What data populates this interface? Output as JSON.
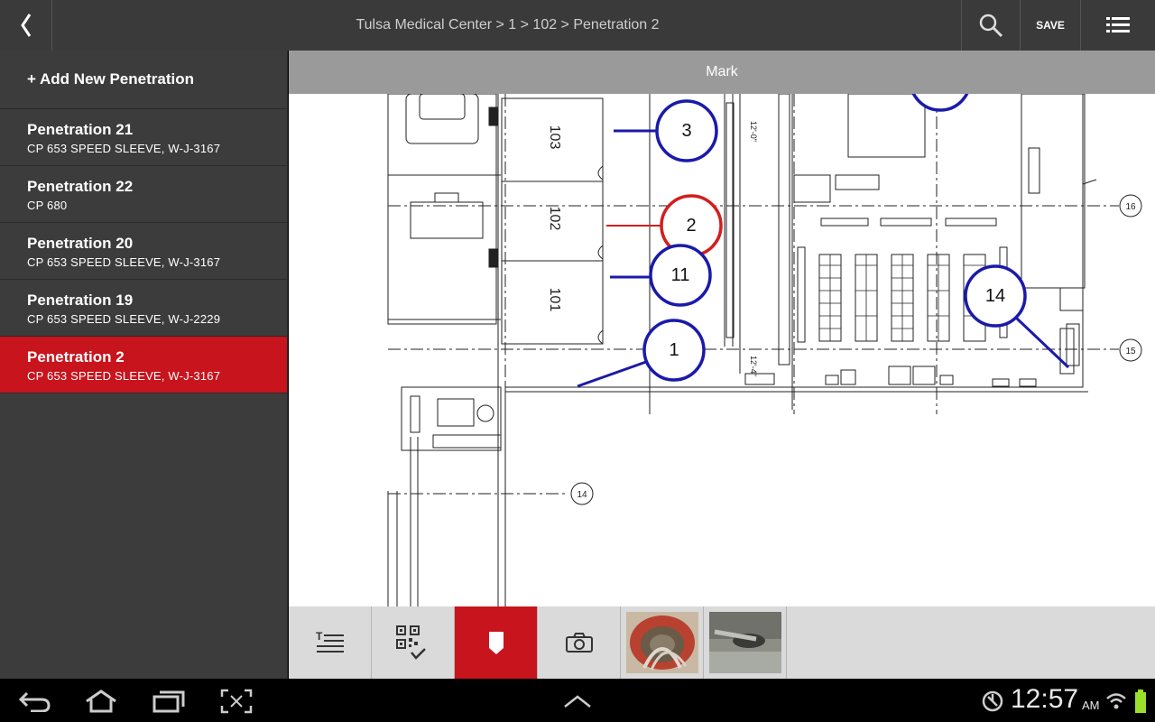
{
  "header": {
    "title": "Tulsa Medical Center > 1 > 102 > Penetration 2",
    "save_label": "SAVE",
    "back_icon": "back-chevron-icon",
    "search_icon": "search-icon",
    "menu_icon": "list-menu-icon"
  },
  "sidebar": {
    "add_label": "+ Add New Penetration",
    "items": [
      {
        "name": "Penetration 21",
        "detail": "CP 653 SPEED SLEEVE, W-J-3167"
      },
      {
        "name": "Penetration 22",
        "detail": "CP 680"
      },
      {
        "name": "Penetration 20",
        "detail": "CP 653 SPEED SLEEVE, W-J-3167"
      },
      {
        "name": "Penetration 19",
        "detail": "CP 653 SPEED SLEEVE, W-J-2229"
      },
      {
        "name": "Penetration 2",
        "detail": "CP 653 SPEED SLEEVE, W-J-3167",
        "selected": true
      }
    ]
  },
  "mark_bar": {
    "label": "Mark"
  },
  "floorplan": {
    "rooms": [
      "103",
      "102",
      "101"
    ],
    "markers": [
      "3",
      "2",
      "11",
      "1",
      "14"
    ],
    "grid_bubbles": [
      "16",
      "15",
      "14"
    ],
    "dims": [
      "12'-0\"",
      "12'-4\""
    ]
  },
  "toolbar": {
    "tools": [
      "text-list-icon",
      "qr-check-icon",
      "marker-icon",
      "camera-icon"
    ],
    "active_tool": "marker-icon",
    "photos": [
      "photo-thumbnail-1",
      "photo-thumbnail-2"
    ]
  },
  "system": {
    "time": "12:57",
    "ampm": "AM",
    "icons": [
      "back-nav-icon",
      "home-icon",
      "recent-apps-icon",
      "screenshot-icon",
      "up-chevron-icon",
      "sync-icon",
      "wifi-icon",
      "battery-icon"
    ]
  },
  "colors": {
    "accent": "#c8141d",
    "marker_blue": "#1a1aaa",
    "marker_red": "#d21e1e",
    "topbar": "#3a3a3a",
    "sidebar": "#3c3c3c"
  }
}
